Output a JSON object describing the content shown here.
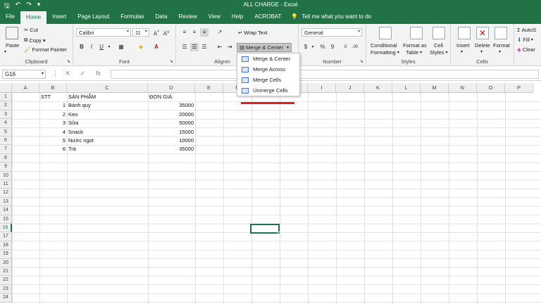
{
  "window": {
    "title": "ALL CHARGE - Excel"
  },
  "ribbon_tabs": [
    "File",
    "Home",
    "Insert",
    "Page Layout",
    "Formulas",
    "Data",
    "Review",
    "View",
    "Help",
    "ACROBAT"
  ],
  "tell_me": "Tell me what you want to do",
  "clipboard": {
    "paste": "Paste",
    "cut": "Cut",
    "copy": "Copy",
    "format_painter": "Format Painter",
    "label": "Clipboard"
  },
  "font": {
    "name": "Calibri",
    "size": "11",
    "bold": "B",
    "italic": "I",
    "underline": "U",
    "label": "Font"
  },
  "alignment": {
    "wrap_text": "Wrap Text",
    "merge_center": "Merge & Center",
    "label": "Alignm"
  },
  "number": {
    "format": "General",
    "currency": "$",
    "percent": "%",
    "comma": "9",
    "label": "Number"
  },
  "styles": {
    "conditional": "Conditional",
    "conditional2": "Formatting",
    "format_as": "Format as",
    "table": "Table",
    "cell": "Cell",
    "cell_styles": "Styles",
    "label": "Styles"
  },
  "cells": {
    "insert": "Insert",
    "delete": "Delete",
    "format": "Format",
    "label": "Cells"
  },
  "editing": {
    "autosum": "AutoS",
    "fill": "Fill",
    "clear": "Clear"
  },
  "merge_menu": [
    "Merge & Center",
    "Merge Across",
    "Merge Cells",
    "Unmerge Cells"
  ],
  "formula_bar": {
    "name_box": "G16",
    "cancel": "✕",
    "enter": "✓",
    "fx": "fx"
  },
  "columns": [
    "A",
    "B",
    "C",
    "D",
    "E",
    "F",
    "G",
    "H",
    "I",
    "J",
    "K",
    "L",
    "M",
    "N",
    "O",
    "P"
  ],
  "rows": [
    "1",
    "2",
    "3",
    "4",
    "5",
    "6",
    "7",
    "8",
    "9",
    "10",
    "11",
    "12",
    "13",
    "14",
    "15",
    "16",
    "17",
    "18",
    "19",
    "20",
    "21",
    "22",
    "23",
    "24"
  ],
  "sheet": {
    "header": {
      "b": "STT",
      "c": "SẢN PHẨM",
      "d": "ĐƠN GIÁ"
    },
    "data": [
      {
        "stt": "1",
        "name": "Bánh quy",
        "price": "35000"
      },
      {
        "stt": "2",
        "name": "Kẹo",
        "price": "20000"
      },
      {
        "stt": "3",
        "name": "Sữa",
        "price": "50000"
      },
      {
        "stt": "4",
        "name": "Snack",
        "price": "15000"
      },
      {
        "stt": "5",
        "name": "Nước ngọt",
        "price": "10000"
      },
      {
        "stt": "6",
        "name": "Trà",
        "price": "35000"
      }
    ]
  },
  "colors": {
    "excel_green": "#217346",
    "annotation_red": "#e02020"
  }
}
